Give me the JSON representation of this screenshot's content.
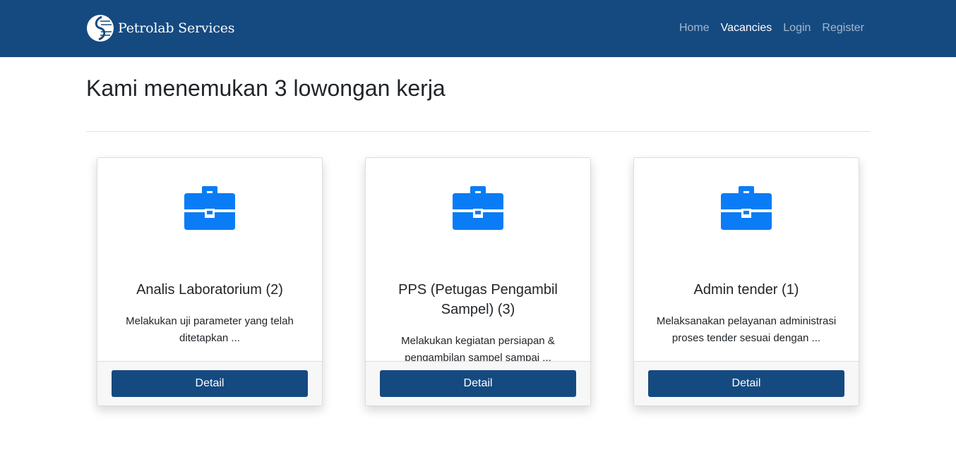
{
  "navbar": {
    "brand": "Petrolab Services",
    "links": [
      {
        "label": "Home",
        "active": false
      },
      {
        "label": "Vacancies",
        "active": true
      },
      {
        "label": "Login",
        "active": false
      },
      {
        "label": "Register",
        "active": false
      }
    ]
  },
  "main": {
    "heading": "Kami menemukan 3 lowongan kerja",
    "vacancies": [
      {
        "title": "Analis Laboratorium (2)",
        "description": "Melakukan uji parameter yang telah ditetapkan  ...",
        "button_label": "Detail",
        "icon": "briefcase-icon"
      },
      {
        "title": "PPS (Petugas Pengambil Sampel) (3)",
        "description": "Melakukan kegiatan persiapan & pengambilan sampel sampai ...",
        "button_label": "Detail",
        "icon": "briefcase-icon"
      },
      {
        "title": "Admin tender (1)",
        "description": "Melaksanakan pelayanan administrasi proses tender sesuai dengan ...",
        "button_label": "Detail",
        "icon": "briefcase-icon"
      }
    ]
  },
  "colors": {
    "navbar_bg": "#154a80",
    "button_bg": "#154a80",
    "icon": "#0a7cf5"
  }
}
